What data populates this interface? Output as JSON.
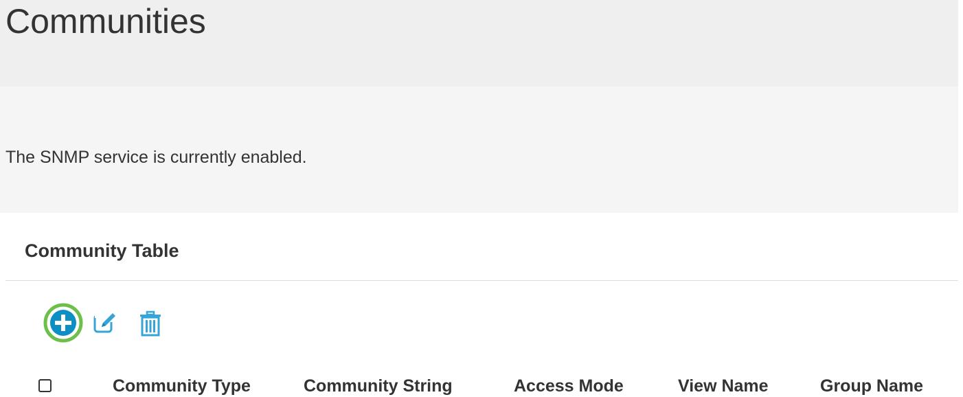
{
  "page": {
    "title": "Communities",
    "status_text": "The SNMP service is currently enabled."
  },
  "panel": {
    "title": "Community Table",
    "toolbar": {
      "add_icon": "plus-circle-icon",
      "edit_icon": "edit-icon",
      "delete_icon": "trash-icon"
    },
    "columns": [
      "Community Type",
      "Community String",
      "Access Mode",
      "View Name",
      "Group Name"
    ]
  },
  "colors": {
    "accent_blue": "#0e8fc4",
    "highlight_green": "#6cc04a",
    "icon_blue": "#36a4d6",
    "text": "#333333"
  }
}
